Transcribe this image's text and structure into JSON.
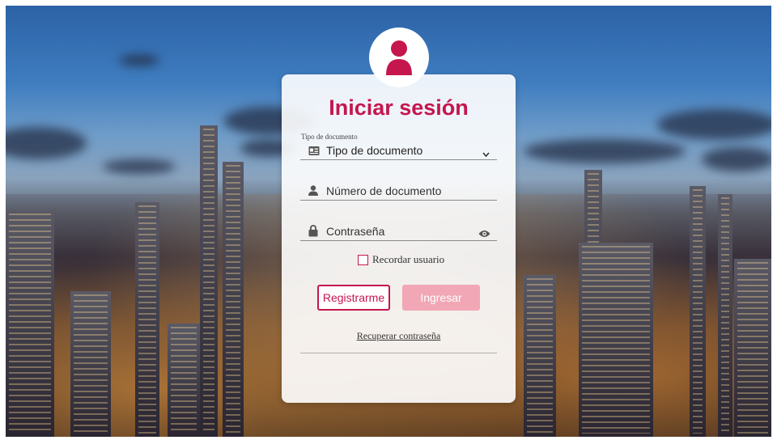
{
  "login": {
    "title": "Iniciar sesión",
    "document_type_label": "Tipo de documento",
    "document_type_value": "Tipo de documento",
    "document_number_placeholder": "Número de documento",
    "password_placeholder": "Contraseña",
    "remember_label": "Recordar usuario",
    "register_label": "Registrarme",
    "login_label": "Ingresar",
    "recover_label": "Recuperar contraseña"
  },
  "icons": {
    "avatar": "user-icon",
    "document_type": "id-card-icon",
    "document_number": "user-icon",
    "password": "lock-icon",
    "toggle_password": "eye-icon",
    "dropdown": "chevron-down-icon"
  },
  "colors": {
    "accent": "#c5164e",
    "login_button": "#f1a7b6"
  }
}
